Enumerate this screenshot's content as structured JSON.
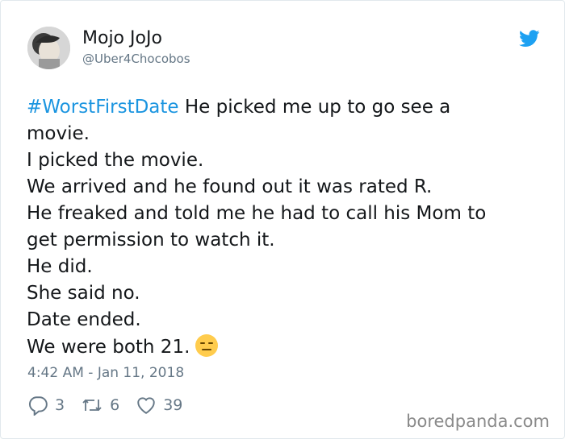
{
  "user": {
    "display_name": "Mojo JoJo",
    "handle": "@Uber4Chocobos",
    "avatar_icon": "user-avatar"
  },
  "brand": {
    "icon": "twitter-bird-icon",
    "color": "#1da1f2"
  },
  "tweet": {
    "hashtag": "#WorstFirstDate",
    "line1_rest": " He picked me up to go see a",
    "line2": "movie.",
    "line3": "I picked the movie.",
    "line4": "We arrived and he found out it was rated R.",
    "line5": "He freaked and told me he had to call his Mom to",
    "line6": "get permission to watch it.",
    "line7": "He did.",
    "line8": "She said no.",
    "line9": "Date ended.",
    "line10": "We were both 21.",
    "emoji": "expressionless-face"
  },
  "timestamp": "4:42 AM - Jan 11, 2018",
  "stats": {
    "replies": "3",
    "retweets": "6",
    "likes": "39"
  },
  "watermark": "boredpanda.com",
  "colors": {
    "hashtag": "#1b95e0",
    "muted": "#657786",
    "text": "#14171a"
  }
}
